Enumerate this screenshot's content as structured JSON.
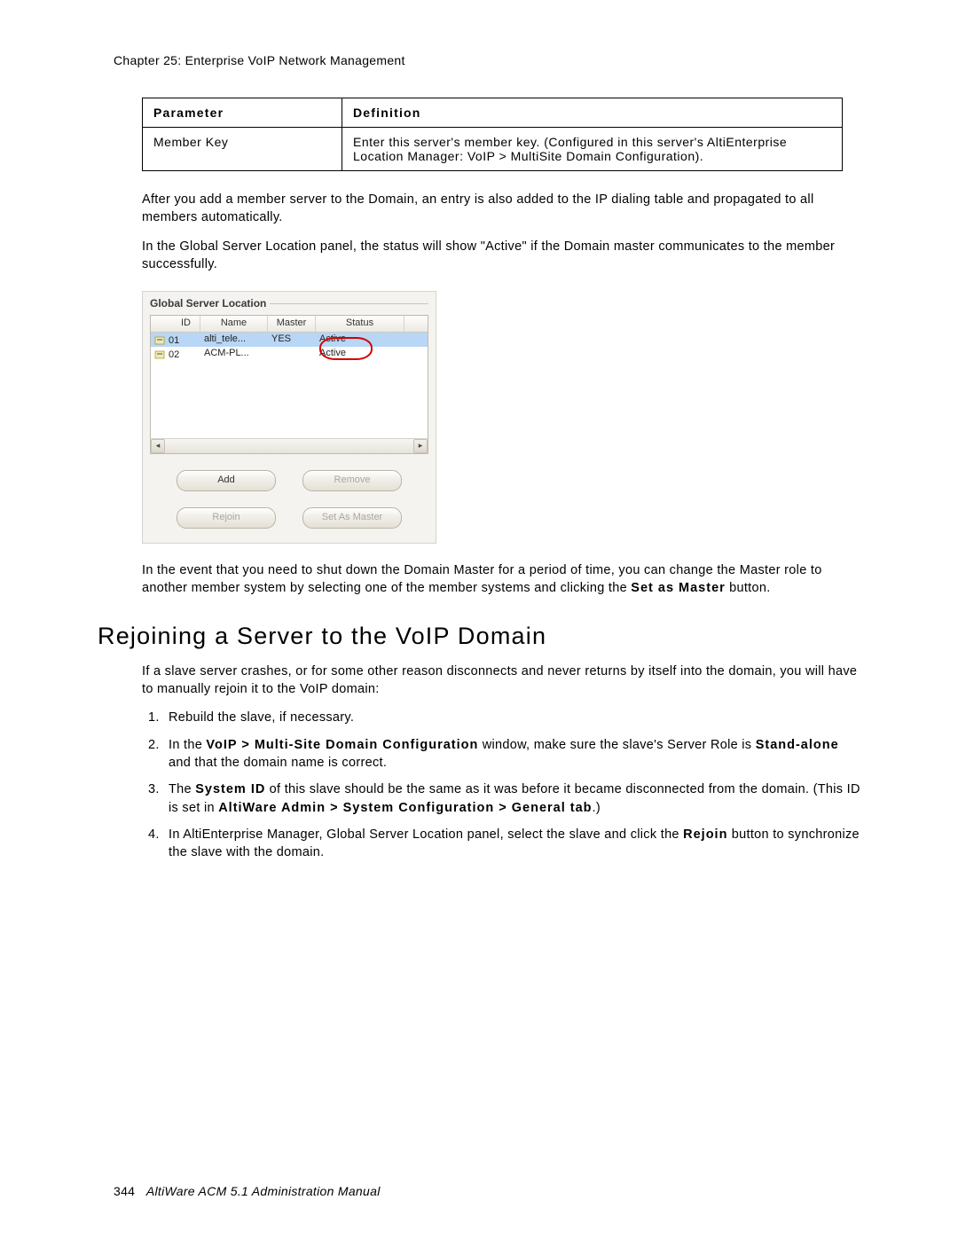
{
  "header": {
    "chapter_line": "Chapter 25:  Enterprise VoIP Network Management"
  },
  "param_table": {
    "head_param": "Parameter",
    "head_def": "Definition",
    "row_param": "Member Key",
    "row_def": "Enter this server's member key. (Configured in this server's AltiEnterprise Location Manager: VoIP > MultiSite Domain Configuration)."
  },
  "para1": "After you add a member server to the Domain, an entry is also added to the IP dialing table and propagated to all members automatically.",
  "para2": "In the Global Server Location panel, the status will show \"Active\" if the Domain master communicates to the member successfully.",
  "panel": {
    "title": "Global Server Location",
    "columns": {
      "id": "ID",
      "name": "Name",
      "master": "Master",
      "status": "Status"
    },
    "rows": [
      {
        "id": "01",
        "name": "alti_tele...",
        "master": "YES",
        "status": "Active"
      },
      {
        "id": "02",
        "name": "ACM-PL...",
        "master": "",
        "status": "Active"
      }
    ],
    "buttons": {
      "add": "Add",
      "remove": "Remove",
      "rejoin": "Rejoin",
      "set_master": "Set As Master"
    }
  },
  "para3_a": "In the event that you need to shut down the Domain Master for a period of time, you can change the Master role to another member system by selecting one of the member systems and clicking the ",
  "para3_b": "Set as Master",
  "para3_c": " button.",
  "section_heading": "Rejoining a Server to the VoIP Domain",
  "para4": "If a slave server crashes, or for some other reason disconnects and never returns by itself into the domain, you will have to manually rejoin it to the VoIP domain:",
  "list": {
    "i1": "Rebuild the slave, if necessary.",
    "i2_a": "In the ",
    "i2_b": "VoIP > Multi-Site Domain Configuration",
    "i2_c": " window, make sure the slave's Server Role is ",
    "i2_d": "Stand-alone",
    "i2_e": " and that the domain name is correct.",
    "i3_a": "The ",
    "i3_b": "System ID",
    "i3_c": " of this slave should be the same as it was before it became disconnected from the domain. (This ID is set in ",
    "i3_d": "AltiWare Admin > System Configuration > General tab",
    "i3_e": ".)",
    "i4_a": "In AltiEnterprise Manager, Global Server Location panel, select the slave and click the ",
    "i4_b": "Rejoin",
    "i4_c": " button to synchronize the slave with the domain."
  },
  "footer": {
    "page_no": "344",
    "title": "AltiWare ACM 5.1 Administration Manual"
  }
}
